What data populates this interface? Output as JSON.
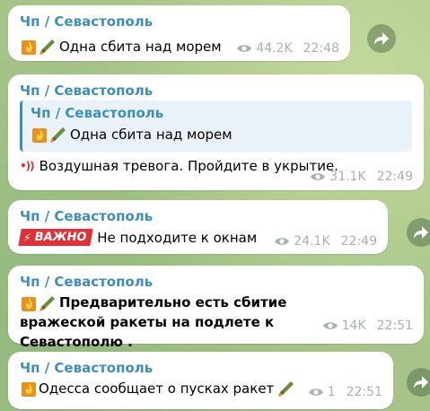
{
  "colors": {
    "background": "#a6c489",
    "bubble": "#ffffff",
    "sender": "#3e8fb8",
    "meta": "#a6b1b6",
    "badge": "#e0313a"
  },
  "messages": [
    {
      "sender": "Чп / Севастополь",
      "text": "Одна сбита над морем",
      "emoji": [
        "fire-emoji",
        "rocket-emoji"
      ],
      "views": "44.2K",
      "time": "22:48"
    },
    {
      "sender": "Чп / Севастополь",
      "reply": {
        "sender": "Чп / Севастополь",
        "text": "Одна сбита над морем"
      },
      "text": "Воздушная тревога. Пройдите в укрытие.",
      "views": "31.1K",
      "time": "22:49"
    },
    {
      "sender": "Чп / Севастополь",
      "badge": "ВАЖНО",
      "text": "Не подходите к окнам",
      "views": "24.1K",
      "time": "22:49"
    },
    {
      "sender": "Чп / Севастополь",
      "text": "Предварительно есть сбитие вражеской ракеты на подлете к Севастополю .",
      "views": "14K",
      "time": "22:51"
    },
    {
      "sender": "Чп / Севастополь",
      "text": "Одесса сообщает о пусках ракет",
      "views": "1",
      "time": "22:51"
    }
  ]
}
